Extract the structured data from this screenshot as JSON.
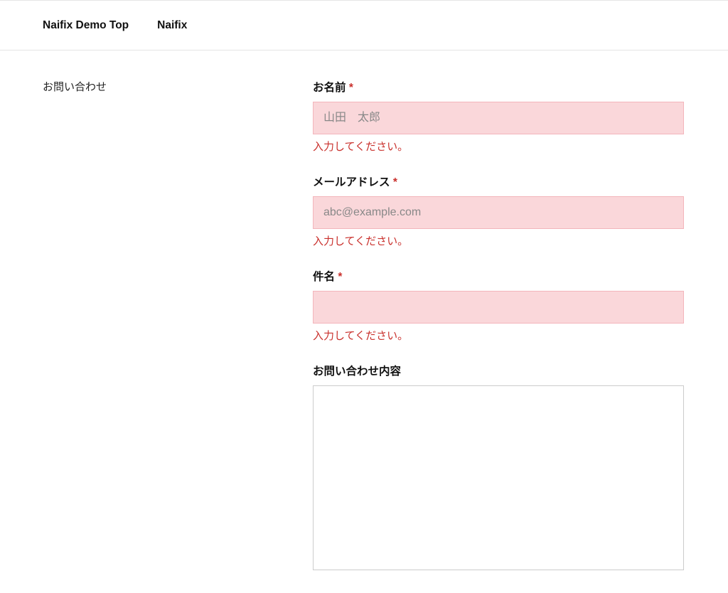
{
  "nav": {
    "link1": "Naifix Demo Top",
    "link2": "Naifix"
  },
  "page": {
    "title": "お問い合わせ"
  },
  "form": {
    "name": {
      "label": "お名前",
      "required_mark": "*",
      "placeholder": "山田　太郎",
      "value": "",
      "error": "入力してください。"
    },
    "email": {
      "label": "メールアドレス",
      "required_mark": "*",
      "placeholder": "abc@example.com",
      "value": "",
      "error": "入力してください。"
    },
    "subject": {
      "label": "件名",
      "required_mark": "*",
      "placeholder": "",
      "value": "",
      "error": "入力してください。"
    },
    "message": {
      "label": "お問い合わせ内容",
      "value": ""
    }
  }
}
